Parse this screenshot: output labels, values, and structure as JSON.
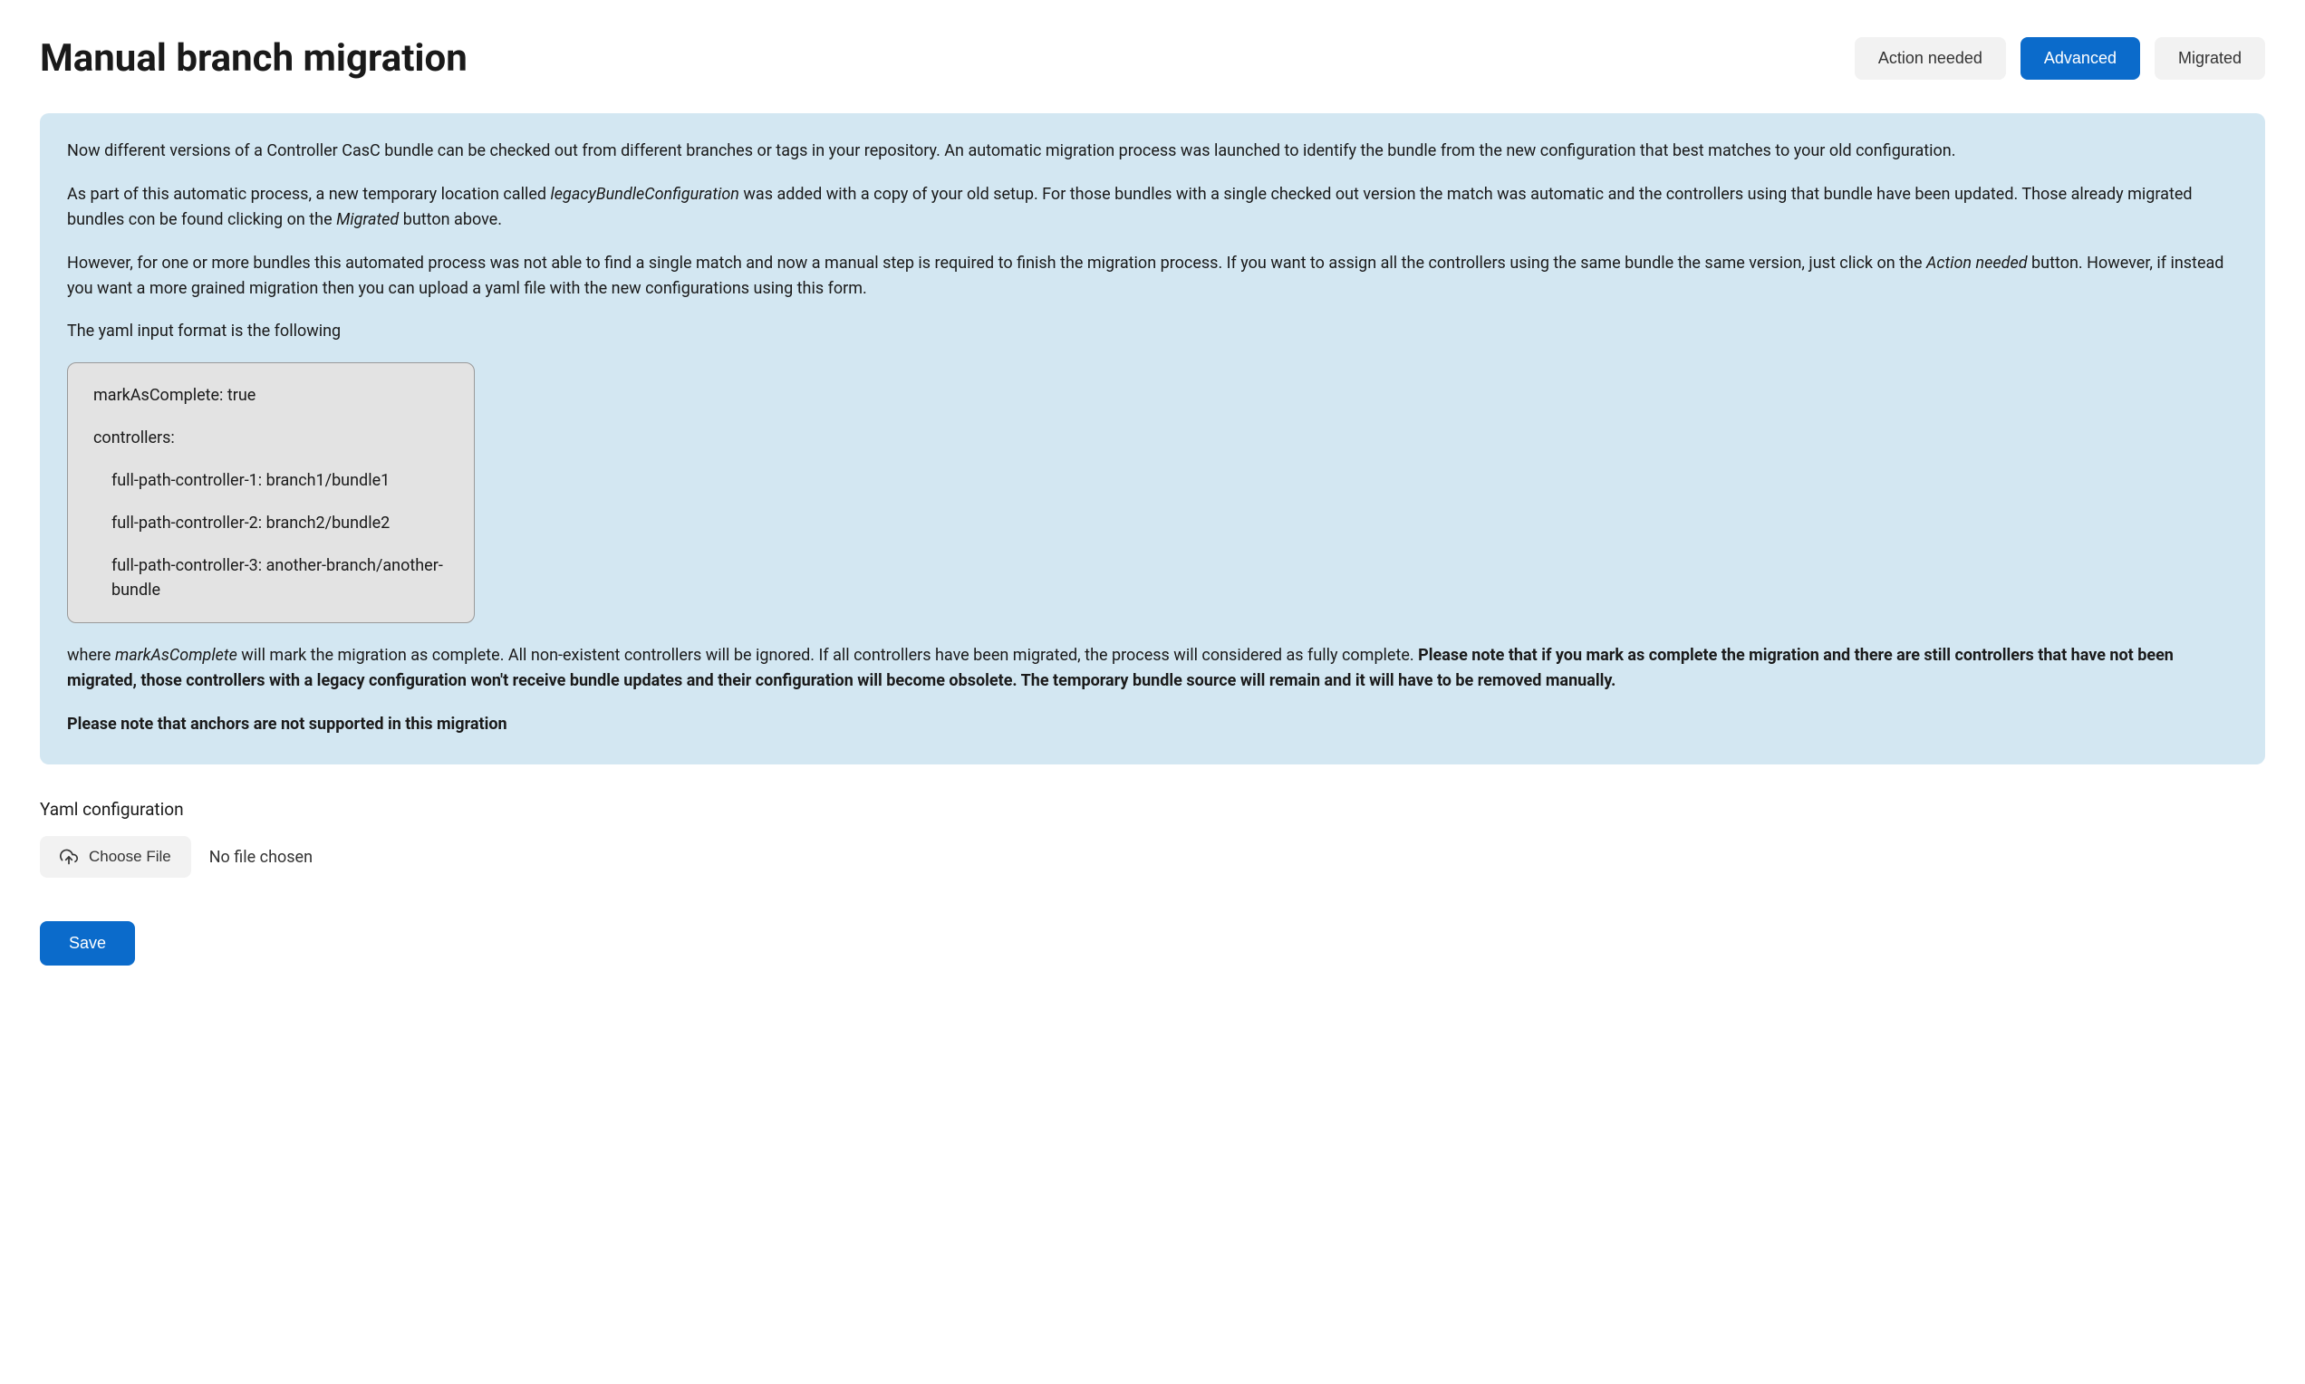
{
  "header": {
    "title": "Manual branch migration",
    "tabs": {
      "action_needed": "Action needed",
      "advanced": "Advanced",
      "migrated": "Migrated"
    }
  },
  "info": {
    "p1": "Now different versions of a Controller CasC bundle can be checked out from different branches or tags in your repository. An automatic migration process was launched to identify the bundle from the new configuration that best matches to your old configuration.",
    "p2_a": "As part of this automatic process, a new temporary location called ",
    "p2_i1": "legacyBundleConfiguration",
    "p2_b": " was added with a copy of your old setup. For those bundles with a single checked out version the match was automatic and the controllers using that bundle have been updated. Those already migrated bundles con be found clicking on the ",
    "p2_i2": "Migrated",
    "p2_c": " button above.",
    "p3_a": "However, for one or more bundles this automated process was not able to find a single match and now a manual step is required to finish the migration process. If you want to assign all the controllers using the same bundle the same version, just click on the ",
    "p3_i1": "Action needed",
    "p3_b": " button. However, if instead you want a more grained migration then you can upload a yaml file with the new configurations using this form.",
    "p4": "The yaml input format is the following",
    "yaml": {
      "l1": "markAsComplete: true",
      "l2": "controllers:",
      "l3": "full-path-controller-1: branch1/bundle1",
      "l4": "full-path-controller-2: branch2/bundle2",
      "l5": "full-path-controller-3: another-branch/another-bundle"
    },
    "p5_a": "where ",
    "p5_i1": "markAsComplete",
    "p5_b": " will mark the migration as complete. All non-existent controllers will be ignored. If all controllers have been migrated, the process will considered as fully complete. ",
    "p5_bold": "Please note that if you mark as complete the migration and there are still controllers that have not been migrated, those controllers with a legacy configuration won't receive bundle updates and their configuration will become obsolete. The temporary bundle source will remain and it will have to be removed manually.",
    "p6": "Please note that anchors are not supported in this migration"
  },
  "form": {
    "section_label": "Yaml configuration",
    "choose_file_label": "Choose File",
    "no_file_text": "No file chosen",
    "save_label": "Save"
  }
}
